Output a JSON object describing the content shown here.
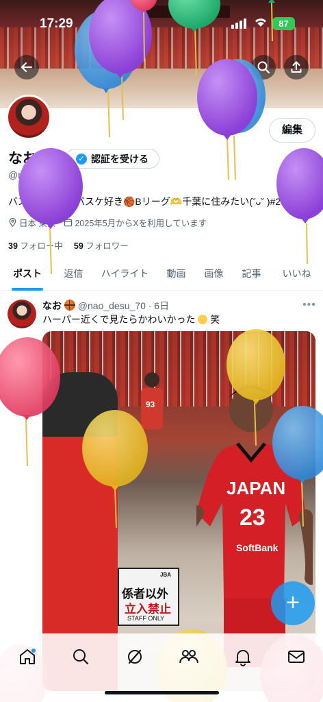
{
  "status_bar": {
    "time": "17:29",
    "battery": "87"
  },
  "profile": {
    "name": "なお",
    "handle": "@nao_desu_70",
    "edit_label": "編集",
    "verify_label": "認証を受ける",
    "bio": "バスケ未経験のバスケ好き🏀Bリーグ🫶千葉に住みたい(˘ᴗ˘ )#2🫶",
    "location": "日本 東京",
    "joined": "2025年5月からXを利用しています",
    "following_count": "39",
    "following_label": "フォロー中",
    "followers_count": "59",
    "followers_label": "フォロワー"
  },
  "tabs": [
    "ポスト",
    "返信",
    "ハイライト",
    "動画",
    "画像",
    "記事",
    "いいね"
  ],
  "active_tab": 0,
  "post": {
    "author": "なお",
    "handle_time": "@nao_desu_70 · 6日",
    "text": "ハーパー近くで見たらかわいかった",
    "text_suffix": "笑",
    "photo": {
      "jersey_text": "JAPAN",
      "jersey_number": "23",
      "jersey_sponsor": "SoftBank",
      "sign_line1": "係者以外",
      "sign_line2": "立入禁止",
      "sign_line3": "STAFF ONLY",
      "sign_logo": "JBA",
      "bench_number": "93"
    }
  },
  "fab_label": "+",
  "bottom_nav": [
    "home-icon",
    "search-icon",
    "grok-icon",
    "communities-icon",
    "notifications-icon",
    "messages-icon"
  ],
  "colors": {
    "accent": "#1d9bf0",
    "balloon_purple": "#9b4fe0",
    "balloon_blue": "#3a9be8",
    "balloon_green": "#2ec27e",
    "balloon_red": "#ef4f72",
    "balloon_yellow": "#f2c935"
  }
}
